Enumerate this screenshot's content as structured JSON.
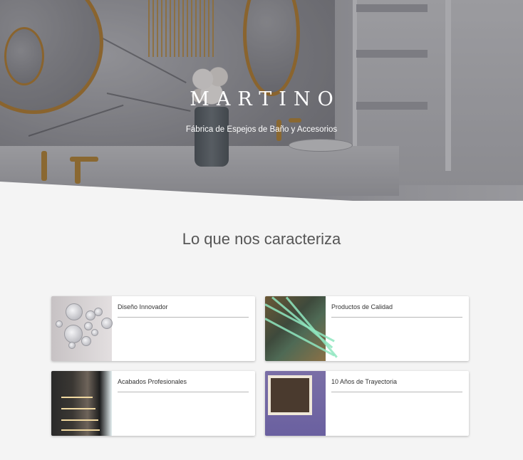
{
  "hero": {
    "brand": "MARTINO",
    "tagline": "Fábrica de Espejos de Baño y Accesorios",
    "image": "bathroom-with-gold-round-mirrors"
  },
  "features": {
    "title": "Lo que nos caracteriza",
    "cards": [
      {
        "title": "Diseño Innovador",
        "image": "decorative-round-mirrors"
      },
      {
        "title": "Productos de Calidad",
        "image": "glass-edges-closeup"
      },
      {
        "title": "Acabados Profesionales",
        "image": "lit-display-shelves"
      },
      {
        "title": "10 Años de Trayectoria",
        "image": "led-backlit-mirror"
      }
    ]
  }
}
